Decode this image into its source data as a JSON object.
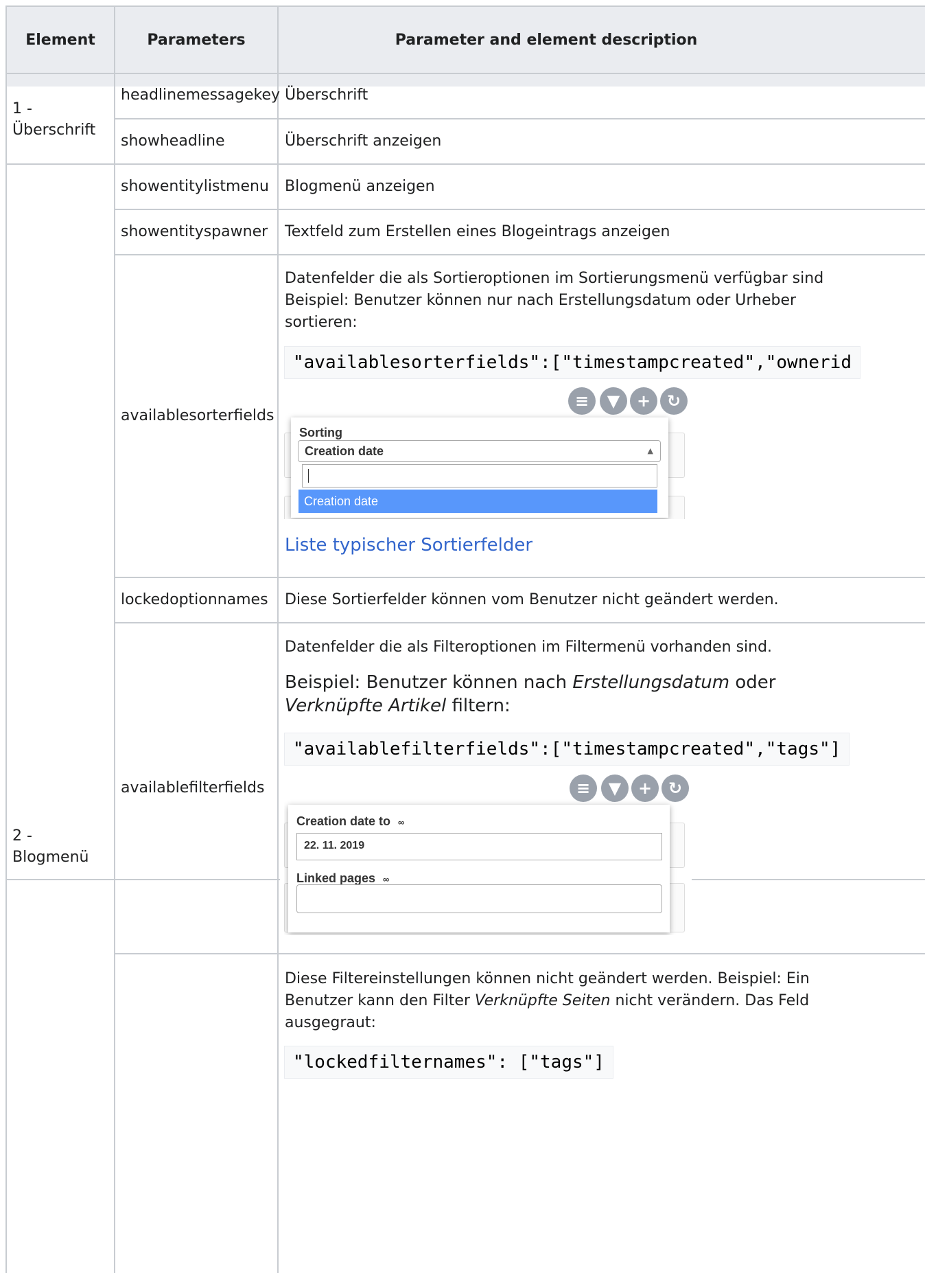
{
  "table": {
    "headers": [
      "Element",
      "Parameters",
      "Parameter and element description"
    ],
    "rows": {
      "headline": {
        "element": [
          "1 -",
          "Überschrift"
        ],
        "params": [
          {
            "name": "headlinemessagekey",
            "desc": "Überschrift"
          },
          {
            "name": "showheadline",
            "desc": "Überschrift anzeigen"
          }
        ]
      },
      "blogmenu": {
        "element": [
          "2 -",
          "Blogmenü"
        ],
        "showentitylistmenu": {
          "name": "showentitylistmenu",
          "desc": "Blogmenü anzeigen"
        },
        "showentityspawner": {
          "name": "showentityspawner",
          "desc": "Textfeld zum Erstellen eines Blogeintrags anzeigen"
        },
        "availablesorterfields": {
          "name": "availablesorterfields",
          "desc_lines": [
            "Datenfelder die als Sortieroptionen im Sortierungsmenü verfügbar sind",
            "Beispiel: Benutzer können nur nach Erstellungsdatum oder Urheber",
            "sortieren:"
          ],
          "code": "\"availablesorterfields\":[\"timestampcreated\",\"ownerid",
          "link": "Liste typischer Sortierfelder",
          "screenshot": {
            "popup_label": "Sorting",
            "selected": "Creation date",
            "option": "Creation date"
          }
        },
        "lockedoptionnames": {
          "name": "lockedoptionnames",
          "desc": "Diese Sortierfelder können vom Benutzer nicht geändert werden."
        },
        "availablefilterfields": {
          "name": "availablefilterfields",
          "desc1": "Datenfelder die als Filteroptionen im Filtermenü vorhanden sind.",
          "desc2_pre": "Beispiel: Benutzer können nach ",
          "desc2_em1": "Erstellungsdatum",
          "desc2_mid": " oder",
          "desc3_em2": "Verknüpfte Artikel",
          "desc3_post": " filtern:",
          "code": "\"availablefilterfields\":[\"timestampcreated\",\"tags\"]",
          "screenshot": {
            "label1": "Creation date to",
            "date_value": "22. 11. 2019",
            "label2": "Linked pages"
          }
        },
        "lockedfilternames": {
          "line1": "Diese Filtereinstellungen können nicht geändert werden. Beispiel: Ein",
          "line2_pre": "Benutzer kann den Filter ",
          "line2_em": "Verknüpfte Seiten",
          "line2_post": " nicht verändern. Das Feld",
          "line3": "ausgegraut:",
          "code": "\"lockedfilternames\": [\"tags\"]"
        }
      }
    }
  },
  "icons": [
    "sort-icon",
    "filter-icon",
    "add-icon",
    "refresh-icon",
    "link-toggle-icon"
  ],
  "colors": {
    "header_bg": "#eaecf0",
    "border": "#c8ccd1",
    "link": "#3366cc",
    "option_highlight": "#5897fb",
    "icon_gray": "#9aa1ab"
  }
}
